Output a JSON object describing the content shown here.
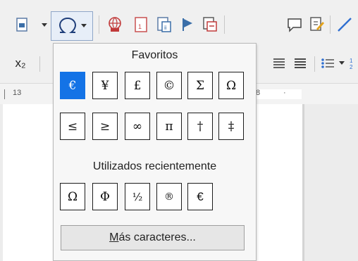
{
  "toolbar": {
    "row1_icons": [
      "insert-field-icon",
      "special-character-icon",
      "hyperlink-icon",
      "footnote-icon",
      "endnote-icon",
      "bookmark-icon",
      "cross-reference-icon",
      "comment-icon",
      "track-changes-icon",
      "line-icon"
    ],
    "row2": {
      "subscript_label": "x₂"
    }
  },
  "ruler": {
    "mark_13": "13",
    "mark_8": "8"
  },
  "special_chars_popup": {
    "favorites_title": "Favoritos",
    "favorites": [
      "€",
      "¥",
      "£",
      "©",
      "Σ",
      "Ω",
      "≤",
      "≥",
      "∞",
      "π",
      "†",
      "‡"
    ],
    "recent_title": "Utilizados recientemente",
    "recent": [
      "Ω",
      "Φ",
      "½",
      "®",
      "€"
    ],
    "more_button_label": "Más caracteres...",
    "selected_index": 0,
    "selected_color": "#1473e6"
  }
}
